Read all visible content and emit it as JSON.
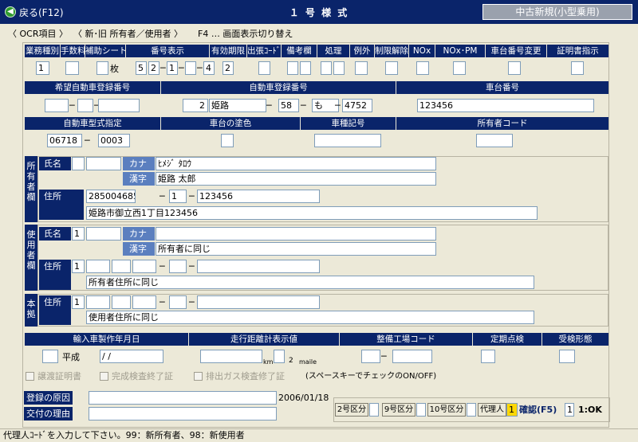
{
  "titlebar": {
    "back": "戻る(F12)",
    "title": "１ 号 様 式",
    "mode": "中古新規(小型乗用)"
  },
  "menu": {
    "ocr": "〈 OCR項目 〉",
    "newold": "〈 新･旧  所有者／使用者 〉",
    "f4": "F4 … 画面表示切り替え"
  },
  "row1": {
    "headers": [
      "業務種別",
      "手数料",
      "補助シート",
      "番号表示",
      "有効期限",
      "出張ｺｰﾄﾞ",
      "備考欄",
      "処理",
      "例外",
      "制限解除",
      "NOx",
      "NOx･PM",
      "車台番号変更",
      "証明書指示"
    ],
    "gyomu": "1",
    "hojo_unit": "枚",
    "bango": [
      "5",
      "2",
      "1",
      "4"
    ],
    "yuko": "2"
  },
  "row2": {
    "headers": [
      "希望自動車登録番号",
      "自動車登録番号",
      "車台番号"
    ],
    "reg": {
      "a": "2",
      "b": "姫路",
      "c": "58",
      "d": "も",
      "e": "4752"
    },
    "chassis": "123456"
  },
  "row3": {
    "headers": [
      "自動車型式指定",
      "車台の塗色",
      "車種記号",
      "所有者コード"
    ],
    "kata_a": "06718",
    "kata_b": "0003"
  },
  "owner": {
    "section": "所有者欄",
    "name_label": "氏名",
    "kana_label": "カナ",
    "kanji_label": "漢字",
    "kana": "ﾋﾒｼﾞ ﾀﾛｳ",
    "kanji": "姫路  太郎",
    "addr_label": "住所",
    "addr_code": "285004685",
    "addr_b": "1",
    "addr_c": "123456",
    "addr_text": "姫路市御立西1丁目123456"
  },
  "user": {
    "section": "使用者欄",
    "name_label": "氏名",
    "name_code": "1",
    "kana_label": "カナ",
    "kanji_label": "漢字",
    "kanji": "所有者に同じ",
    "addr_label": "住所",
    "addr_code": "1",
    "addr_text": "所有者住所に同じ"
  },
  "base": {
    "section": "本拠",
    "addr_label": "住所",
    "addr_code": "1",
    "addr_text": "使用者住所に同じ"
  },
  "row4": {
    "headers": [
      "輸入車製作年月日",
      "走行距離計表示値",
      "整備工場コード",
      "定期点検",
      "受検形態"
    ],
    "era": "平成",
    "date": "/  /",
    "km": "km",
    "unit_val": "2",
    "unit": "maile"
  },
  "checks": {
    "a": "譲渡証明書",
    "b": "完成検査終了証",
    "c": "排出ガス検査修了証",
    "note": "(スペースキーでチェックのON/OFF)"
  },
  "bottom": {
    "reason_reg": "登録の原因",
    "reason_issue": "交付の理由",
    "date": "2006/01/18",
    "k2": "2号区分",
    "k9": "9号区分",
    "k10": "10号区分",
    "agent": "代理人",
    "agent_val": "1",
    "confirm": "確認(F5)",
    "confirm_val": "1",
    "ok": "1:OK"
  },
  "status": "代理人ｺｰﾄﾞを入力して下さい。99：新所有者、98：新使用者"
}
